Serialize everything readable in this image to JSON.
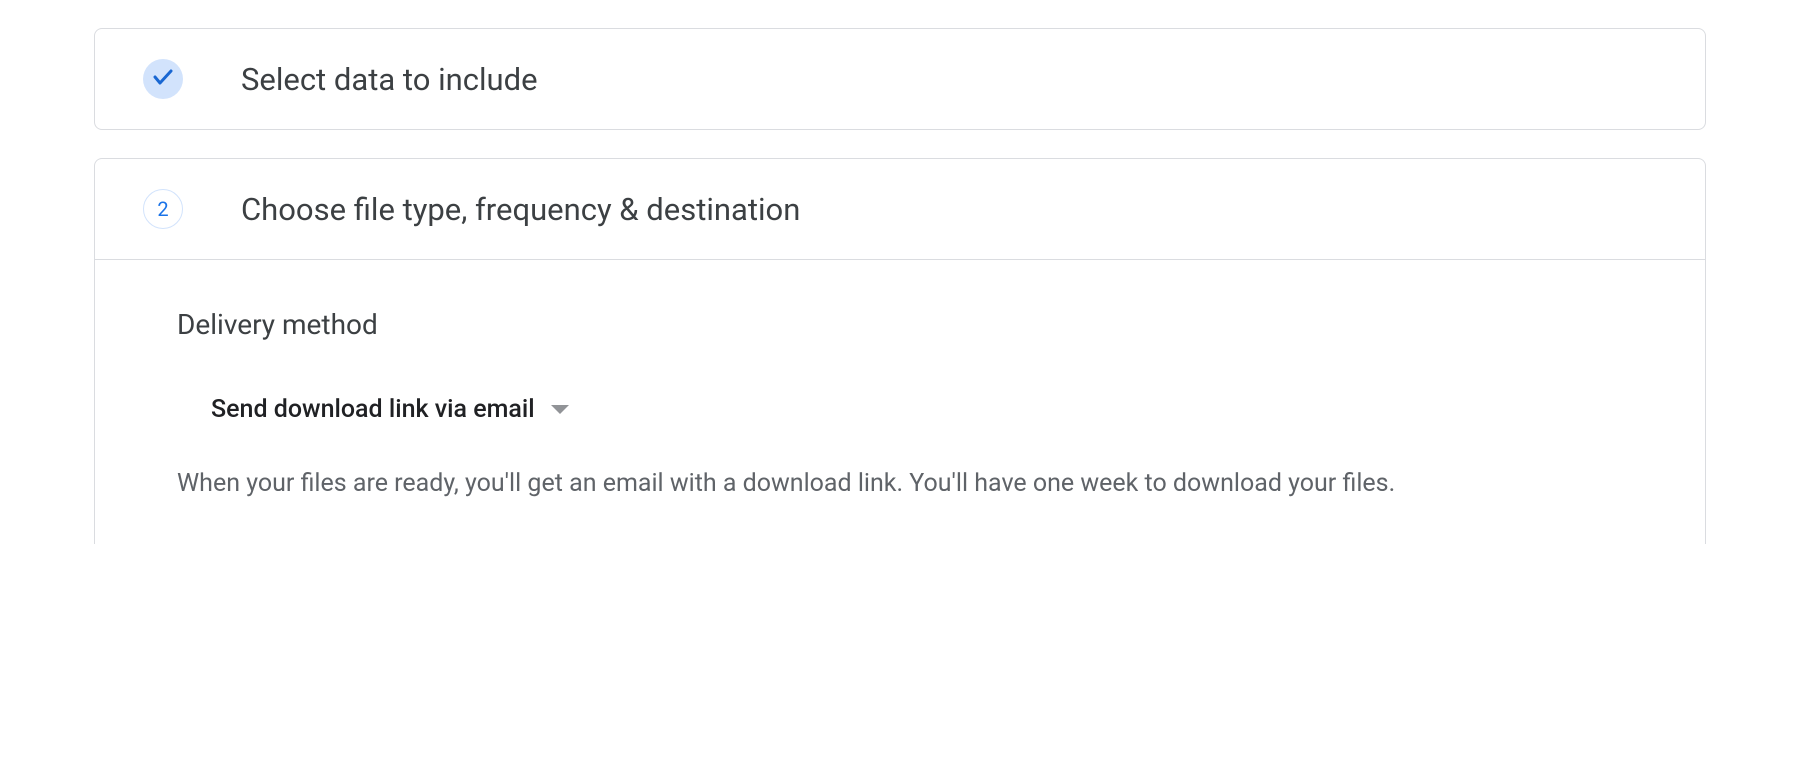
{
  "step1": {
    "title": "Select data to include"
  },
  "step2": {
    "number": "2",
    "title": "Choose file type, frequency & destination",
    "delivery": {
      "heading": "Delivery method",
      "selected": "Send download link via email",
      "description": "When your files are ready, you'll get an email with a download link. You'll have one week to download your files."
    }
  }
}
